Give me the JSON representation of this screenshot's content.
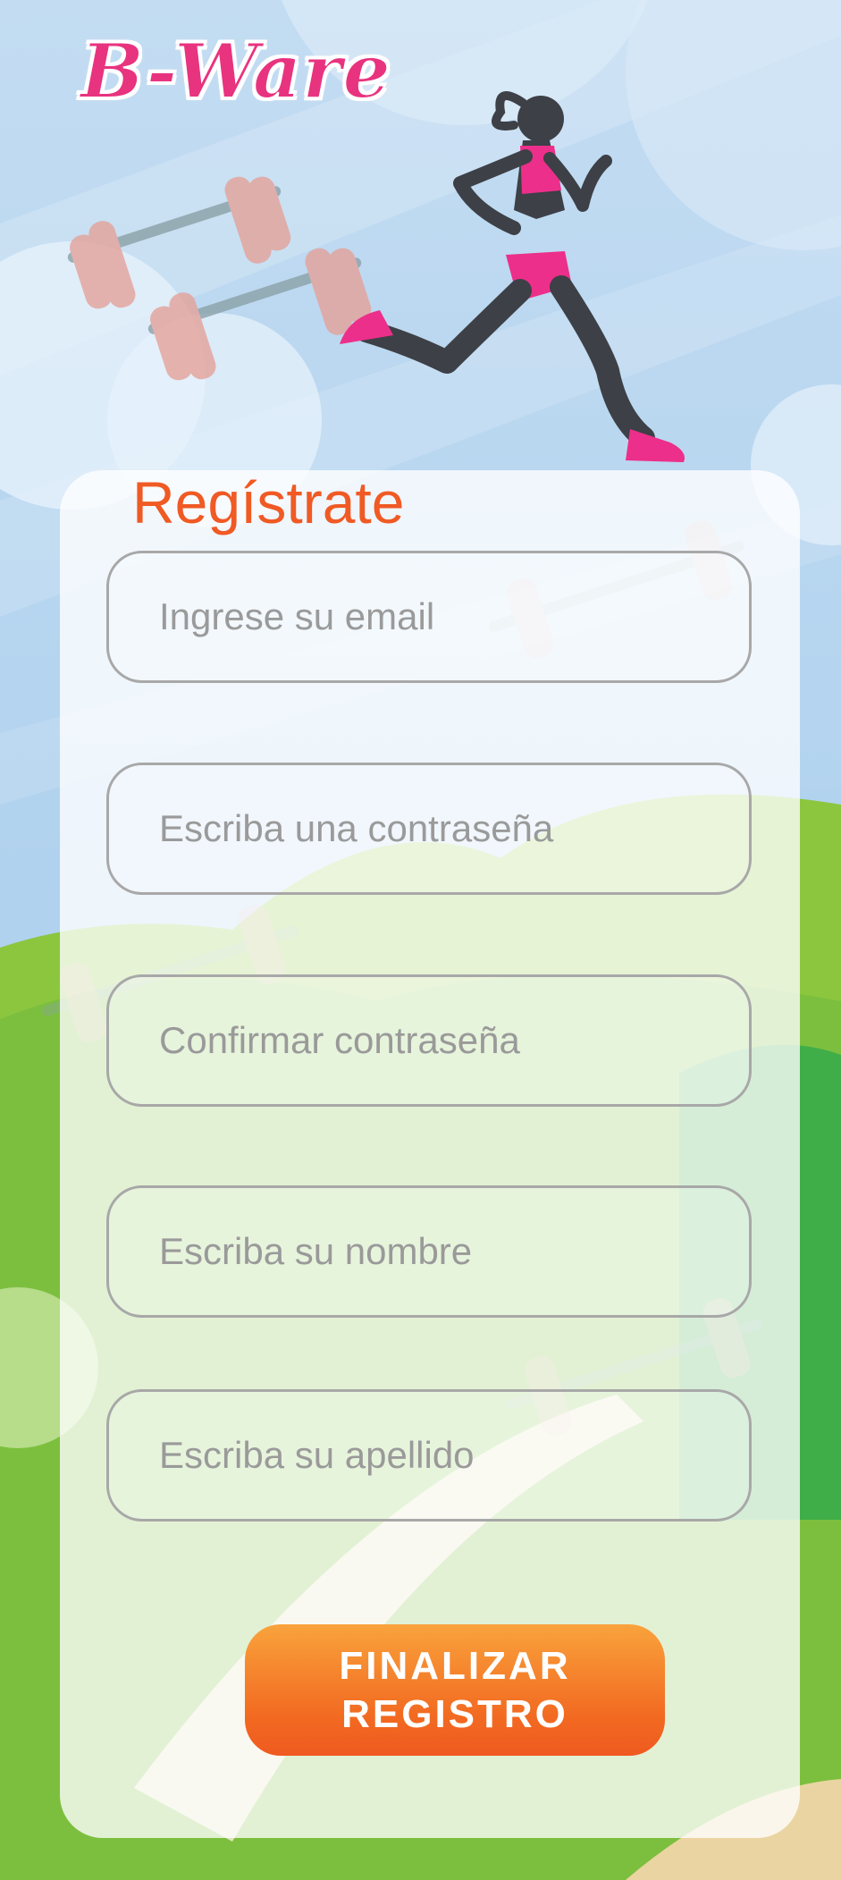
{
  "brand": {
    "logo_text": "B-Ware"
  },
  "form": {
    "title": "Regístrate",
    "email_placeholder": "Ingrese su email",
    "password_placeholder": "Escriba una contraseña",
    "confirm_password_placeholder": "Confirmar contraseña",
    "first_name_placeholder": "Escriba su nombre",
    "last_name_placeholder": "Escriba su apellido",
    "submit_line1": "FINALIZAR",
    "submit_line2": "REGISTRO"
  },
  "colors": {
    "brand": "#e8337f",
    "title": "#f05a24",
    "button_top": "#f9a33c",
    "button_bottom": "#ef5a20",
    "sky": "#a9cfee",
    "grass": "#7cbf3e"
  },
  "icons": [
    "dumbbell-icon",
    "runner-illustration"
  ]
}
